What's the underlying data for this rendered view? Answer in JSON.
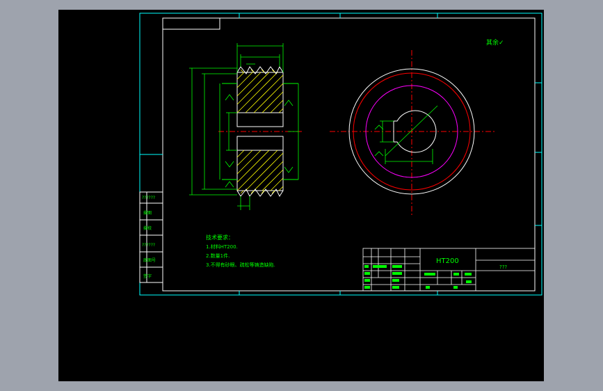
{
  "colors": {
    "background": "#000000",
    "viewport_bg": "#9ea3ad",
    "frame": "#00ffff",
    "dimension": "#00ff00",
    "part": "#ffffff",
    "centerline": "#ff0000",
    "pitch_circle": "#ff00ff",
    "hatch": "#ffff00",
    "text_label": "#00ff00"
  },
  "title_block": {
    "material": "HT200",
    "part_name": "???"
  },
  "notes": {
    "heading": "技术要求：",
    "items": [
      "1.材料HT200.",
      "2.数量1件.",
      "3.不得有砂眼、疏松等铸造缺陷."
    ]
  },
  "left_column": [
    "??????",
    "描图",
    "描校",
    "??????",
    "底图号",
    "签字"
  ],
  "roughness_symbol": "其余✓"
}
